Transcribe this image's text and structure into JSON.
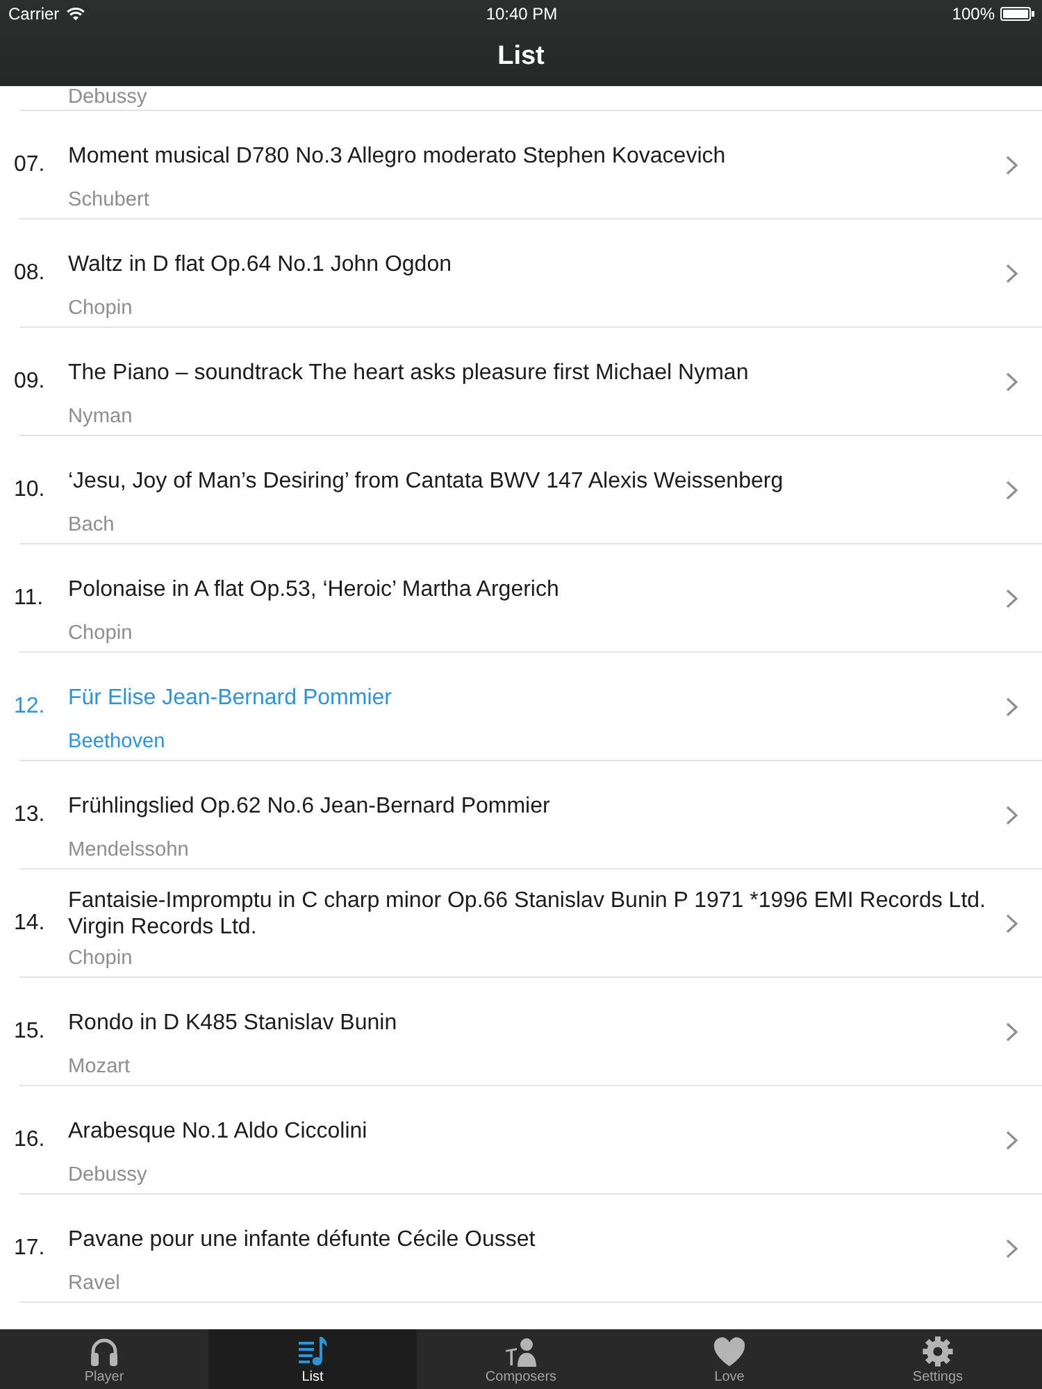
{
  "status_bar": {
    "carrier": "Carrier",
    "time": "10:40 PM",
    "battery": "100%"
  },
  "nav_bar": {
    "title": "List"
  },
  "list": {
    "partial_row": {
      "subtitle": "Debussy"
    },
    "rows": [
      {
        "number": "07.",
        "title": "Moment musical D780 No.3 Allegro moderato Stephen Kovacevich",
        "subtitle": "Schubert",
        "selected": false
      },
      {
        "number": "08.",
        "title": "Waltz in D flat Op.64 No.1 John Ogdon",
        "subtitle": "Chopin",
        "selected": false
      },
      {
        "number": "09.",
        "title": "The Piano – soundtrack The heart asks pleasure first Michael Nyman",
        "subtitle": "Nyman",
        "selected": false
      },
      {
        "number": "10.",
        "title": "‘Jesu, Joy of Man’s Desiring’ from Cantata BWV 147 Alexis Weissenberg",
        "subtitle": "Bach",
        "selected": false
      },
      {
        "number": "11.",
        "title": "Polonaise in A flat Op.53, ‘Heroic’ Martha Argerich",
        "subtitle": "Chopin",
        "selected": false
      },
      {
        "number": "12.",
        "title": "Für Elise Jean-Bernard Pommier",
        "subtitle": "Beethoven",
        "selected": true
      },
      {
        "number": "13.",
        "title": "Frühlingslied Op.62 No.6 Jean-Bernard Pommier",
        "subtitle": "Mendelssohn",
        "selected": false
      },
      {
        "number": "14.",
        "title": "Fantaisie-Impromptu in C charp minor Op.66 Stanislav Bunin P 1971 *1996 EMI Records Ltd. Virgin Records Ltd.",
        "subtitle": "Chopin",
        "selected": false
      },
      {
        "number": "15.",
        "title": "Rondo in D K485 Stanislav Bunin",
        "subtitle": "Mozart",
        "selected": false
      },
      {
        "number": "16.",
        "title": "Arabesque No.1 Aldo Ciccolini",
        "subtitle": "Debussy",
        "selected": false
      },
      {
        "number": "17.",
        "title": "Pavane pour une infante défunte Cécile Ousset",
        "subtitle": "Ravel",
        "selected": false
      }
    ]
  },
  "tab_bar": {
    "tabs": [
      {
        "label": "Player",
        "selected": false
      },
      {
        "label": "List",
        "selected": true
      },
      {
        "label": "Composers",
        "selected": false
      },
      {
        "label": "Love",
        "selected": false
      },
      {
        "label": "Settings",
        "selected": false
      }
    ]
  }
}
